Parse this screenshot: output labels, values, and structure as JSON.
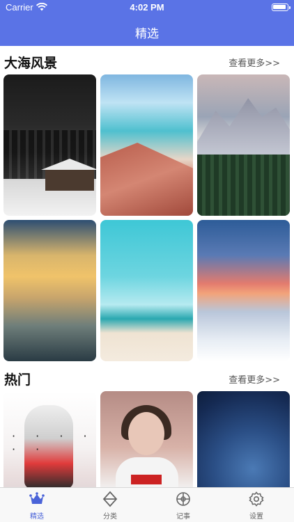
{
  "status_bar": {
    "carrier": "Carrier",
    "time": "4:02 PM"
  },
  "nav": {
    "title": "精选"
  },
  "sections": [
    {
      "title": "大海风景",
      "more": "查看更多>>"
    },
    {
      "title": "热门",
      "more": "查看更多>>"
    }
  ],
  "tiles": [
    {
      "icon": "snow-cabin-image"
    },
    {
      "icon": "beach-cliff-image"
    },
    {
      "icon": "mountain-forest-image"
    },
    {
      "icon": "sunset-coast-image"
    },
    {
      "icon": "turquoise-sea-image"
    },
    {
      "icon": "sunset-clouds-image"
    },
    {
      "icon": "anime-girls-image"
    },
    {
      "icon": "girl-portrait-image"
    },
    {
      "icon": "space-dragon-image"
    }
  ],
  "hot_dots": "· · · · · ·",
  "tabbar": {
    "items": [
      {
        "label": "精选",
        "active": true,
        "icon": "crown-icon"
      },
      {
        "label": "分类",
        "active": false,
        "icon": "diamond-icon"
      },
      {
        "label": "记事",
        "active": false,
        "icon": "target-icon"
      },
      {
        "label": "设置",
        "active": false,
        "icon": "gear-icon"
      }
    ]
  },
  "colors": {
    "accent": "#5a73e6",
    "tab_active": "#4a63d8"
  }
}
